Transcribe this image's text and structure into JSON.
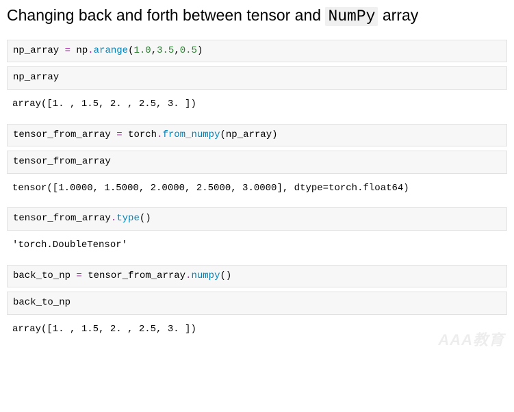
{
  "title": {
    "pre": "Changing back and forth between tensor and ",
    "hl": "NumPy",
    "post": " array"
  },
  "cells": [
    {
      "type": "in",
      "tokens": [
        {
          "t": "np_array ",
          "c": ""
        },
        {
          "t": "=",
          "c": "tok-op"
        },
        {
          "t": " np",
          "c": ""
        },
        {
          "t": ".",
          "c": "tok-op"
        },
        {
          "t": "arange",
          "c": "tok-fn"
        },
        {
          "t": "(",
          "c": ""
        },
        {
          "t": "1.0",
          "c": "tok-num"
        },
        {
          "t": ",",
          "c": ""
        },
        {
          "t": "3.5",
          "c": "tok-num"
        },
        {
          "t": ",",
          "c": ""
        },
        {
          "t": "0.5",
          "c": "tok-num"
        },
        {
          "t": ")",
          "c": ""
        }
      ]
    },
    {
      "type": "in",
      "tokens": [
        {
          "t": "np_array",
          "c": ""
        }
      ]
    },
    {
      "type": "out",
      "text": "array([1. , 1.5, 2. , 2.5, 3. ])"
    },
    {
      "type": "in",
      "tokens": [
        {
          "t": "tensor_from_array ",
          "c": ""
        },
        {
          "t": "=",
          "c": "tok-op"
        },
        {
          "t": " torch",
          "c": ""
        },
        {
          "t": ".",
          "c": "tok-op"
        },
        {
          "t": "from_numpy",
          "c": "tok-fn"
        },
        {
          "t": "(np_array)",
          "c": ""
        }
      ]
    },
    {
      "type": "in",
      "tokens": [
        {
          "t": "tensor_from_array",
          "c": ""
        }
      ]
    },
    {
      "type": "out",
      "text": "tensor([1.0000, 1.5000, 2.0000, 2.5000, 3.0000], dtype=torch.float64)"
    },
    {
      "type": "in",
      "tokens": [
        {
          "t": "tensor_from_array",
          "c": ""
        },
        {
          "t": ".",
          "c": "tok-op"
        },
        {
          "t": "type",
          "c": "tok-fn"
        },
        {
          "t": "()",
          "c": ""
        }
      ]
    },
    {
      "type": "out",
      "text": "'torch.DoubleTensor'"
    },
    {
      "type": "in",
      "tokens": [
        {
          "t": "back_to_np ",
          "c": ""
        },
        {
          "t": "=",
          "c": "tok-op"
        },
        {
          "t": " tensor_from_array",
          "c": ""
        },
        {
          "t": ".",
          "c": "tok-op"
        },
        {
          "t": "numpy",
          "c": "tok-fn"
        },
        {
          "t": "()",
          "c": ""
        }
      ]
    },
    {
      "type": "in",
      "tokens": [
        {
          "t": "back_to_np",
          "c": ""
        }
      ]
    },
    {
      "type": "out",
      "text": "array([1. , 1.5, 2. , 2.5, 3. ])"
    }
  ],
  "watermark": "AAA教育"
}
